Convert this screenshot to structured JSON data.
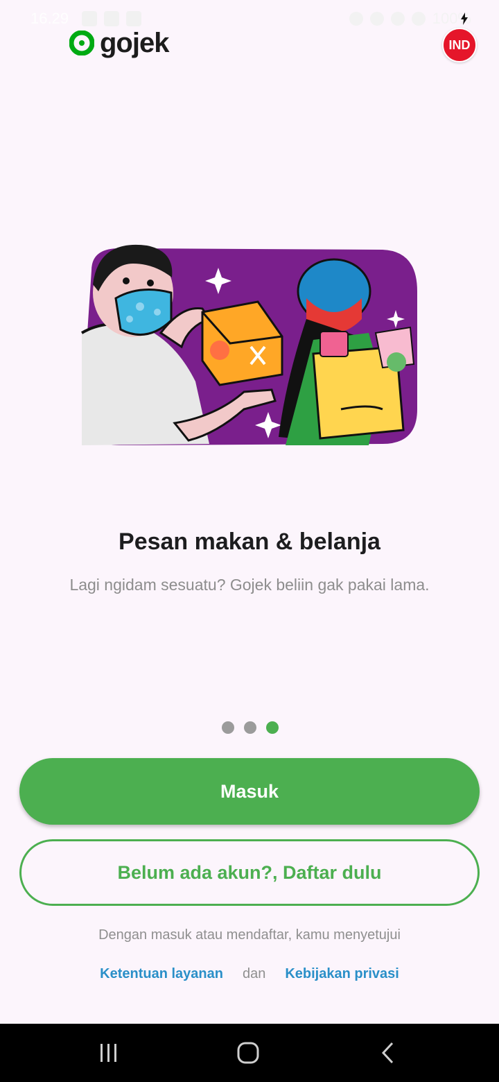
{
  "status_bar": {
    "time": "16.29",
    "battery": "100%"
  },
  "header": {
    "brand": "gojek",
    "language": "IND"
  },
  "onboarding": {
    "title": "Pesan makan & belanja",
    "subtitle": "Lagi ngidam sesuatu? Gojek beliin gak pakai lama.",
    "pages_total": 3,
    "current_page": 3
  },
  "actions": {
    "login_label": "Masuk",
    "register_label": "Belum ada akun?, Daftar dulu"
  },
  "legal": {
    "consent_text": "Dengan masuk atau mendaftar, kamu menyetujui",
    "terms_link": "Ketentuan layanan",
    "and_text": "dan",
    "privacy_link": "Kebijakan privasi"
  },
  "colors": {
    "primary": "#4caf50",
    "link": "#2a8fc8",
    "background": "#fcf5fc",
    "badge": "#e5162a"
  }
}
